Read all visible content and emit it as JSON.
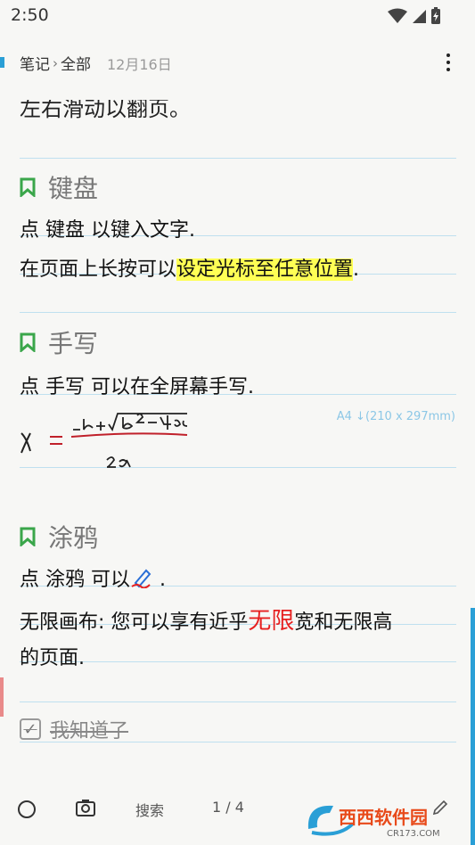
{
  "status": {
    "time": "2:50"
  },
  "header": {
    "crumb_root": "笔记",
    "crumb_current": "全部",
    "date": "12月16日"
  },
  "note": {
    "clipped_line": "左右滑动以翻页。",
    "sections": [
      {
        "heading": "键盘",
        "lines": [
          "点 键盘 以键入文字.",
          "在页面上长按可以",
          "设定光标至任意位置",
          "."
        ]
      },
      {
        "heading": "手写",
        "lines": [
          "点 手写 可以在全屏幕手写."
        ]
      },
      {
        "heading": "涂鸦",
        "lines": [
          "点 涂鸦 可以",
          " .",
          "无限画布: 您可以享有近乎",
          "无限",
          "宽和无限高",
          "的页面."
        ]
      }
    ],
    "page_size_label": "A4 ↓(210 x 297mm)",
    "checkbox_label": "我知道了"
  },
  "bottom_bar": {
    "search": "搜索",
    "page": "1 / 4"
  },
  "watermark": {
    "text": "西西软件园",
    "sub": "CR173.COM"
  },
  "colors": {
    "accent": "#2a9fd6",
    "bookmark": "#3aa64a",
    "highlight": "#ffff55",
    "red": "#e62020"
  }
}
